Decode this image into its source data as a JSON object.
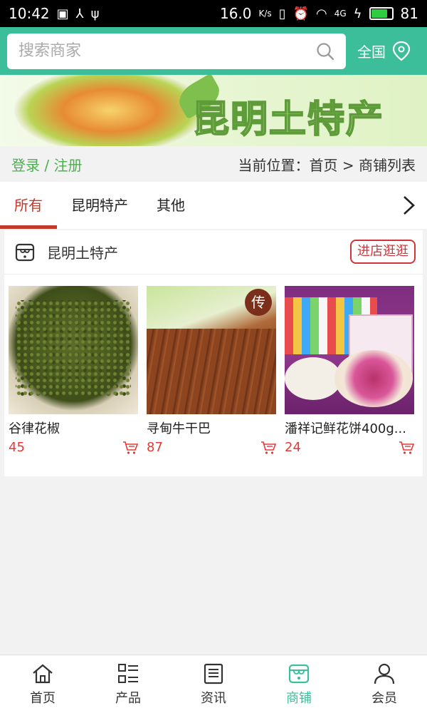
{
  "status_bar": {
    "time": "10:42",
    "speed": "16.0",
    "speed_unit": "K/s",
    "network": "4G",
    "battery_level": 81,
    "battery_text": "81"
  },
  "search": {
    "placeholder": "搜索商家",
    "region_label": "全国"
  },
  "banner": {
    "title": "昆明土特产"
  },
  "crumb": {
    "login": "登录 / 注册",
    "location": "当前位置：首页 > 商铺列表"
  },
  "tabs": [
    {
      "label": "所有",
      "active": true
    },
    {
      "label": "昆明特产",
      "active": false
    },
    {
      "label": "其他",
      "active": false
    }
  ],
  "shop": {
    "name": "昆明土特产",
    "visit_label": "进店逛逛",
    "products": [
      {
        "name": "谷律花椒",
        "price": "45"
      },
      {
        "name": "寻甸牛干巴",
        "price": "87",
        "badge": "传"
      },
      {
        "name": "潘祥记鲜花饼400g...",
        "price": "24"
      }
    ]
  },
  "bottom_nav": [
    {
      "label": "首页",
      "icon": "home-icon",
      "active": false
    },
    {
      "label": "产品",
      "icon": "list-icon",
      "active": false
    },
    {
      "label": "资讯",
      "icon": "news-icon",
      "active": false
    },
    {
      "label": "商铺",
      "icon": "store-icon",
      "active": true
    },
    {
      "label": "会员",
      "icon": "user-icon",
      "active": false
    }
  ],
  "colors": {
    "accent": "#3dbe9a",
    "price": "#e53935",
    "tab_active": "#c0392b"
  }
}
